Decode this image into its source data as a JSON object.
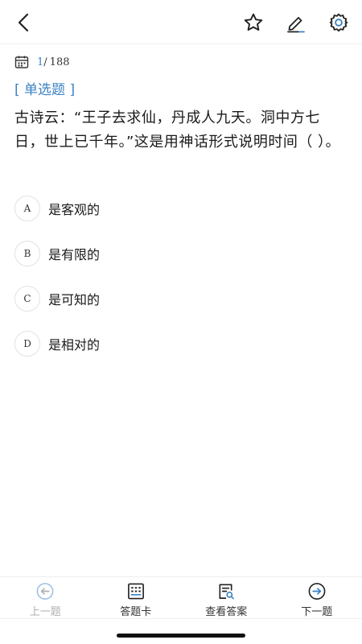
{
  "toolbar": {
    "back_icon": "chevron-left-icon",
    "favorite_icon": "star-icon",
    "edit_icon": "pen-icon",
    "settings_icon": "gear-icon"
  },
  "progress": {
    "current": "1",
    "separator": "/",
    "total": "188"
  },
  "question": {
    "type": "[ 单选题 ]",
    "text": "古诗云：“王子去求仙，丹成人九天。洞中方七日，世上已千年。”这是用神话形式说明时间（ ）。",
    "options": [
      {
        "letter": "A",
        "text": "是客观的"
      },
      {
        "letter": "B",
        "text": "是有限的"
      },
      {
        "letter": "C",
        "text": "是可知的"
      },
      {
        "letter": "D",
        "text": "是相对的"
      }
    ]
  },
  "bottom_nav": {
    "prev": "上一题",
    "card": "答题卡",
    "answer": "查看答案",
    "next": "下一题"
  },
  "colors": {
    "accent": "#3b82c4",
    "text": "#1a1a1a",
    "disabled": "#b0b0b0",
    "border": "#e2e2e2"
  }
}
